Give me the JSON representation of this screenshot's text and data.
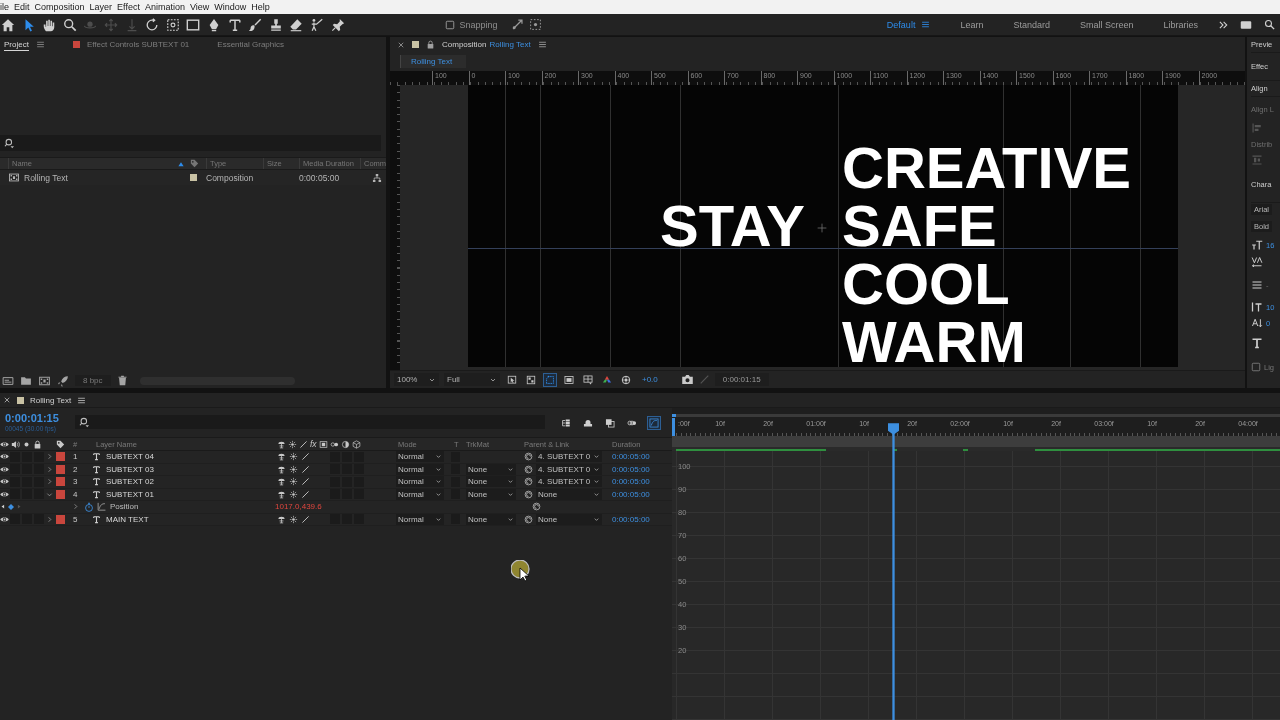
{
  "menu_bar": [
    "ile",
    "Edit",
    "Composition",
    "Layer",
    "Effect",
    "Animation",
    "View",
    "Window",
    "Help"
  ],
  "toolbar": {
    "tools": [
      {
        "kind": "home",
        "selected": false,
        "disabled": false
      },
      {
        "kind": "selection",
        "selected": true,
        "disabled": false
      },
      {
        "kind": "hand",
        "selected": false,
        "disabled": false
      },
      {
        "kind": "zoom",
        "selected": false,
        "disabled": false
      },
      {
        "kind": "orbit",
        "selected": false,
        "disabled": true
      },
      {
        "kind": "pan",
        "selected": false,
        "disabled": true
      },
      {
        "kind": "dolly",
        "selected": false,
        "disabled": true
      },
      {
        "kind": "rotate",
        "selected": false,
        "disabled": false
      },
      {
        "kind": "anchor",
        "selected": false,
        "disabled": false
      },
      {
        "kind": "rectangle",
        "selected": false,
        "disabled": false
      },
      {
        "kind": "pen",
        "selected": false,
        "disabled": false
      },
      {
        "kind": "type",
        "selected": false,
        "disabled": false
      },
      {
        "kind": "brush",
        "selected": false,
        "disabled": false
      },
      {
        "kind": "stamp",
        "selected": false,
        "disabled": false
      },
      {
        "kind": "eraser",
        "selected": false,
        "disabled": false
      },
      {
        "kind": "roto",
        "selected": false,
        "disabled": false
      },
      {
        "kind": "pin",
        "selected": false,
        "disabled": false
      }
    ],
    "snapping": {
      "label": "Snapping",
      "checked": false
    },
    "workspaces": [
      {
        "label": "Default",
        "selected": true
      },
      {
        "label": "Learn",
        "selected": false
      },
      {
        "label": "Standard",
        "selected": false
      },
      {
        "label": "Small Screen",
        "selected": false
      },
      {
        "label": "Libraries",
        "selected": false
      }
    ]
  },
  "project_panel": {
    "tabs": [
      {
        "label": "Project",
        "selected": true
      },
      {
        "label": "Effect Controls SUBTEXT 01",
        "selected": false,
        "color": "#c9463d"
      },
      {
        "label": "Essential Graphics",
        "selected": false
      }
    ],
    "columns": [
      "Name",
      "Type",
      "Size",
      "Media Duration",
      "Comm"
    ],
    "items": [
      {
        "name": "Rolling Text",
        "color": "#c9c2a4",
        "type": "Composition",
        "media_duration": "0:00:05:00",
        "selected": false
      }
    ],
    "bit_depth": "8 bpc"
  },
  "composition_panel": {
    "tab": {
      "prefix": "Composition",
      "name": "Rolling Text"
    },
    "breadcrumb": "Rolling Text",
    "ruler_labels": [
      "100",
      "0",
      "100",
      "200",
      "300",
      "400",
      "500",
      "600",
      "700",
      "800",
      "900",
      "1000",
      "1100",
      "1200",
      "1300",
      "1400",
      "1500",
      "1600",
      "1700",
      "1800",
      "1900",
      "2000"
    ],
    "canvas": {
      "left_word": "STAY",
      "right_words": [
        "CREATIVE",
        "SAFE",
        "COOL",
        "WARM"
      ]
    },
    "zoom": "100%",
    "resolution": "Full",
    "toggles": [
      {
        "kind": "fast-preview",
        "on": false
      },
      {
        "kind": "transparency",
        "on": false
      },
      {
        "kind": "mask",
        "on": true
      },
      {
        "kind": "region",
        "on": false
      },
      {
        "kind": "grid",
        "on": false
      },
      {
        "kind": "channels",
        "on": false
      },
      {
        "kind": "exposure-reset",
        "on": false
      }
    ],
    "exposure": "+0.0",
    "time": "0:00:01:15"
  },
  "side_panel": [
    {
      "kind": "header",
      "label": "Previe"
    },
    {
      "kind": "header",
      "label": "Effec"
    },
    {
      "kind": "header",
      "label": "Align"
    },
    {
      "kind": "label",
      "label": "Align L"
    },
    {
      "kind": "align-icons"
    },
    {
      "kind": "label",
      "label": "Distrib"
    },
    {
      "kind": "distribute-icons"
    },
    {
      "kind": "header",
      "label": "Chara"
    },
    {
      "kind": "dropdown",
      "label": "Arial"
    },
    {
      "kind": "dropdown",
      "label": "Bold"
    },
    {
      "kind": "font-size",
      "label": "16"
    },
    {
      "kind": "tracking"
    },
    {
      "kind": "paragraph",
      "label": "-"
    },
    {
      "kind": "vertical-scale",
      "label": "10"
    },
    {
      "kind": "baseline-shift",
      "label": "0"
    },
    {
      "kind": "faux-styles"
    },
    {
      "kind": "checkbox",
      "label": "Lig",
      "checked": false
    }
  ],
  "timeline": {
    "tab": "Rolling Text",
    "current_time": "0:00:01:15",
    "frame_info": "00045 (30.00 fps)",
    "tools": [
      {
        "kind": "hierarchy",
        "selected": false
      },
      {
        "kind": "shy",
        "selected": false
      },
      {
        "kind": "frame-blend",
        "selected": false
      },
      {
        "kind": "motion-blur",
        "selected": false
      },
      {
        "kind": "graph-editor",
        "selected": true
      }
    ],
    "column_labels": {
      "number": "#",
      "layer_name": "Layer Name",
      "fx": "fx",
      "mode": "Mode",
      "t": "T",
      "trkmat": "TrkMat",
      "parent": "Parent & Link",
      "duration": "Duration"
    },
    "layers": [
      {
        "number": "1",
        "name": "SUBTEXT 04",
        "color": "#c9463d",
        "visible": true,
        "selected": false,
        "expanded": false,
        "mode": "Normal",
        "parent": "4. SUBTEXT 0",
        "duration": "0:00:05:00"
      },
      {
        "number": "2",
        "name": "SUBTEXT 03",
        "color": "#c9463d",
        "visible": true,
        "selected": false,
        "expanded": false,
        "mode": "Normal",
        "trkmat": "None",
        "parent": "4. SUBTEXT 0",
        "duration": "0:00:05:00"
      },
      {
        "number": "3",
        "name": "SUBTEXT 02",
        "color": "#c9463d",
        "visible": true,
        "selected": false,
        "expanded": false,
        "mode": "Normal",
        "trkmat": "None",
        "parent": "4. SUBTEXT 0",
        "duration": "0:00:05:00"
      },
      {
        "number": "4",
        "name": "SUBTEXT 01",
        "color": "#c9463d",
        "visible": true,
        "selected": false,
        "expanded": true,
        "mode": "Normal",
        "trkmat": "None",
        "parent": "None",
        "duration": "0:00:05:00",
        "properties": [
          {
            "name": "Position",
            "value": "1017.0,439.6",
            "stopwatch_on": true
          }
        ]
      },
      {
        "number": "5",
        "name": "MAIN TEXT",
        "color": "#c9463d",
        "visible": true,
        "selected": false,
        "expanded": false,
        "mode": "Normal",
        "trkmat": "None",
        "parent": "None",
        "duration": "0:00:05:00"
      }
    ],
    "graph_editor": {
      "time_labels": [
        ":00f",
        "10f",
        "20f",
        "01:00f",
        "10f",
        "20f",
        "02:00f",
        "10f",
        "20f",
        "03:00f",
        "10f",
        "20f",
        "04:00f"
      ],
      "value_labels": [
        "100",
        "90",
        "80",
        "70",
        "60",
        "50",
        "40",
        "30",
        "20"
      ],
      "playhead": {
        "level": 0.365
      }
    }
  }
}
